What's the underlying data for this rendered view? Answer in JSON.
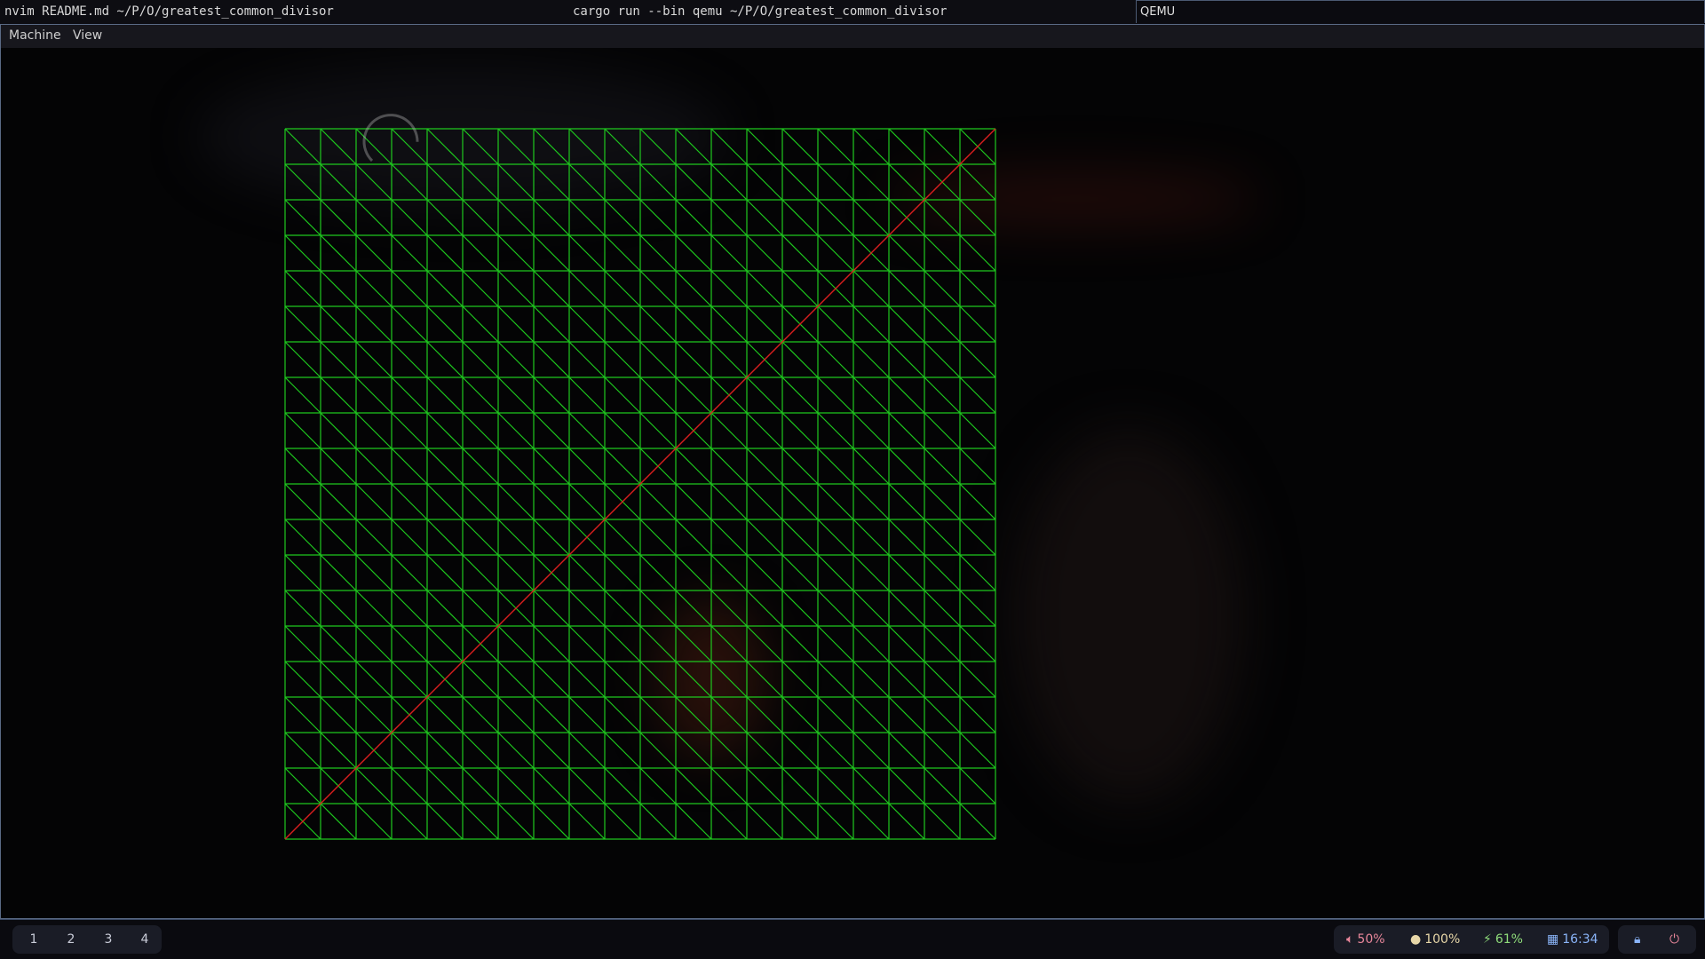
{
  "topbar": {
    "left_title": "nvim README.md ~/P/O/greatest_common_divisor",
    "center_title": "cargo run --bin qemu ~/P/O/greatest_common_divisor",
    "right_window_title": "QEMU"
  },
  "qemu": {
    "menu": [
      "Machine",
      "View"
    ]
  },
  "grid_visual": {
    "cells": 20,
    "grid_color": "#1ec81e",
    "diagonal_color": "#d81e1e"
  },
  "statusbar": {
    "workspaces": [
      "1",
      "2",
      "3",
      "4"
    ],
    "volume": "50%",
    "brightness": "100%",
    "battery": "61%",
    "clock": "16:34",
    "colors": {
      "volume": "#e8869a",
      "brightness": "#e8d7a8",
      "battery": "#8fdc7a",
      "clock": "#8ab4f8",
      "lock": "#8ab4f8",
      "power": "#e8869a"
    }
  }
}
